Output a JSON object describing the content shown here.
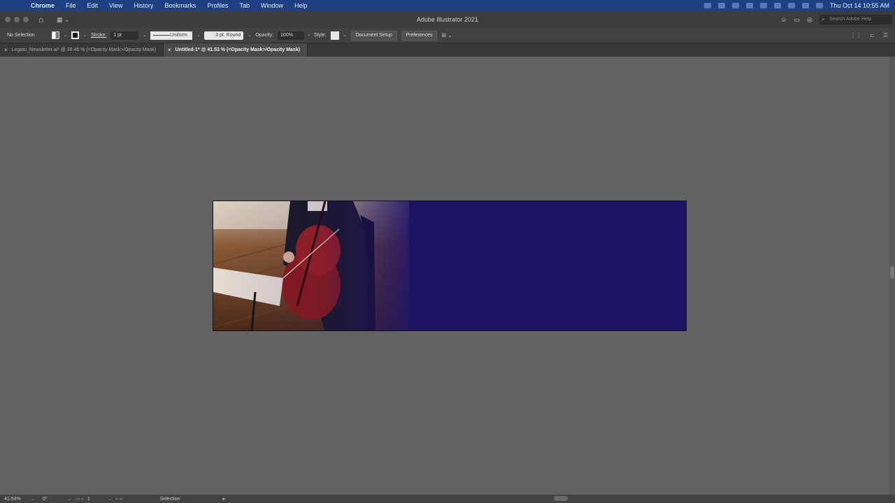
{
  "menubar": {
    "apple_icon": "apple-icon",
    "items": [
      "Chrome",
      "File",
      "Edit",
      "View",
      "History",
      "Bookmarks",
      "Profiles",
      "Tab",
      "Window",
      "Help"
    ],
    "clock": "Thu Oct 14  10:55 AM"
  },
  "titlebar": {
    "title": "Adobe Illustrator 2021",
    "search_placeholder": "Search Adobe Help"
  },
  "control_bar": {
    "selection_label": "No Selection",
    "stroke_label": "Stroke:",
    "stroke_weight": "1 pt",
    "stroke_profile": "Uniform",
    "brush": "3 pt. Round",
    "opacity_label": "Opacity:",
    "opacity_value": "100%",
    "style_label": "Style:",
    "document_setup": "Document Setup",
    "preferences": "Preferences"
  },
  "tabs": [
    {
      "label": "Legato_Newsletter.ai* @ 38.46 % (<Opacity Mask>/Opacity Mask)",
      "active": false
    },
    {
      "label": "Untitled-1* @ 41.53 % (<Opacity Mask>/Opacity Mask)",
      "active": true
    }
  ],
  "status_bar": {
    "zoom": "41.53%",
    "rotation": "0°",
    "artboard": "1",
    "tool": "Selection"
  },
  "colors": {
    "artboard_fill": "#1e1464",
    "menubar_bg": "#1f3f83",
    "canvas_bg": "#636363"
  }
}
